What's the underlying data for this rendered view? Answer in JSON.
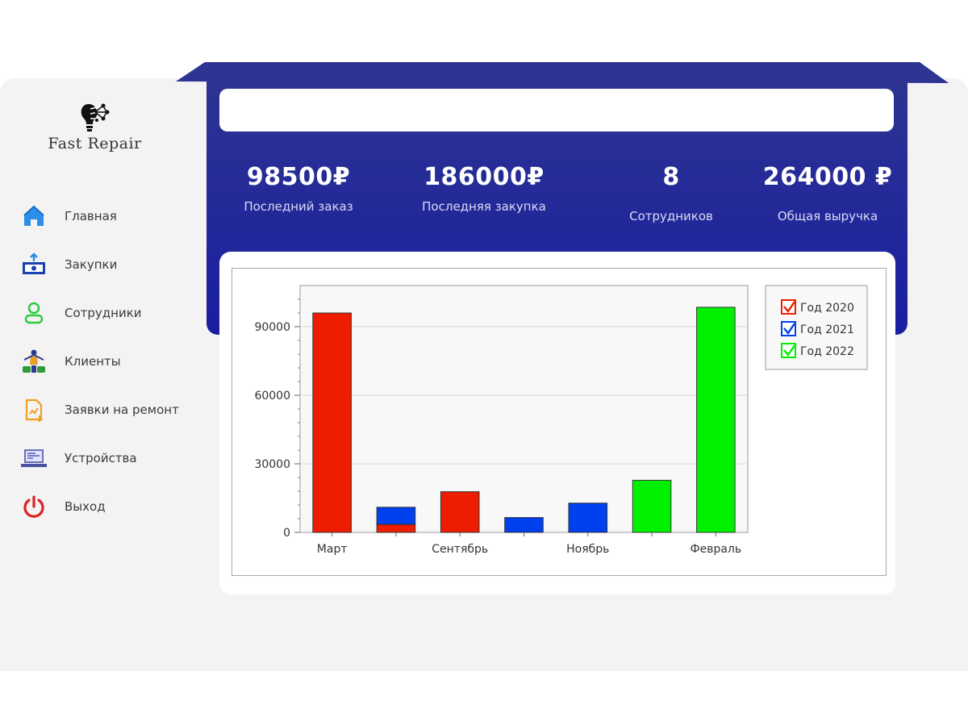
{
  "app": {
    "logo_text": "Fast Repair"
  },
  "search": {
    "placeholder": ""
  },
  "stats": [
    {
      "value": "98500₽",
      "label": "Последний заказ"
    },
    {
      "value": "186000₽",
      "label": "Последняя закупка"
    },
    {
      "value": "8",
      "label": "Сотрудников"
    },
    {
      "value": "264000 ₽",
      "label": "Общая выручка"
    }
  ],
  "sidebar": {
    "items": [
      {
        "label": "Главная",
        "icon": "home-icon"
      },
      {
        "label": "Закупки",
        "icon": "purchase-icon"
      },
      {
        "label": "Сотрудники",
        "icon": "employee-icon"
      },
      {
        "label": "Клиенты",
        "icon": "clients-icon"
      },
      {
        "label": "Заявки на ремонт",
        "icon": "repair-request-icon"
      },
      {
        "label": "Устройства",
        "icon": "devices-icon"
      },
      {
        "label": "Выход",
        "icon": "power-icon"
      }
    ]
  },
  "colors": {
    "header": "#1e2399",
    "y2020": "#ee1c00",
    "y2021": "#0040ee",
    "y2022": "#00f000"
  },
  "chart_data": {
    "type": "bar",
    "categories": [
      "Март",
      "",
      "Сентябрь",
      "",
      "Ноябрь",
      "",
      "Февраль"
    ],
    "series": [
      {
        "name": "Год 2020",
        "color": "#ee1c00",
        "values": [
          96000,
          3500,
          17800,
          0,
          0,
          0,
          0
        ]
      },
      {
        "name": "Год 2021",
        "color": "#0040ee",
        "values": [
          0,
          7500,
          0,
          6500,
          12800,
          0,
          0
        ]
      },
      {
        "name": "Год 2022",
        "color": "#00f000",
        "values": [
          0,
          0,
          0,
          0,
          0,
          22800,
          98500
        ]
      }
    ],
    "stacked": true,
    "yticks": [
      "0",
      "30000",
      "60000",
      "90000"
    ],
    "ylim": [
      0,
      108000
    ],
    "legend": "top-right",
    "grid": true
  }
}
